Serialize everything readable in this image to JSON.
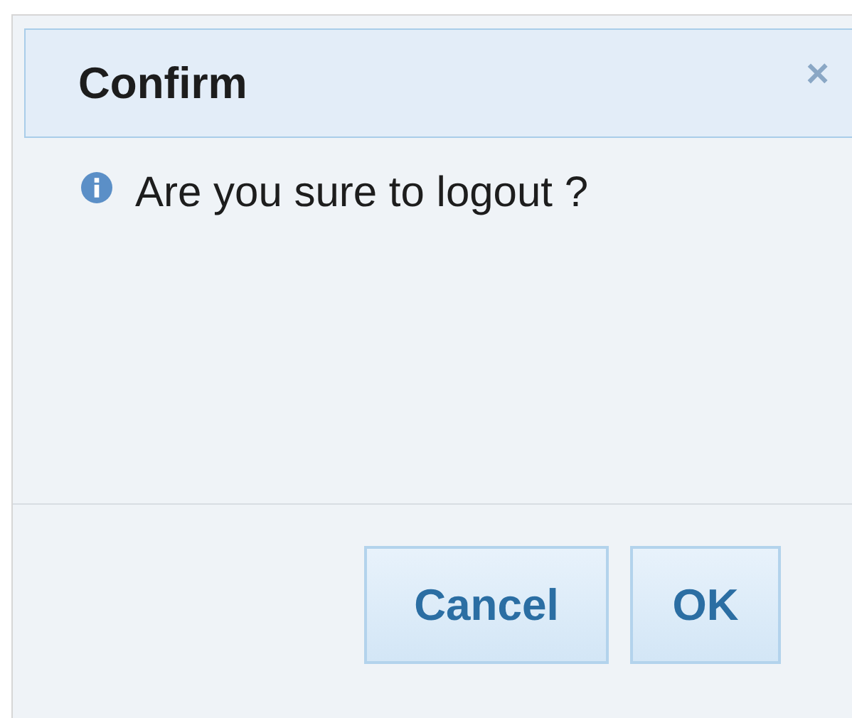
{
  "dialog": {
    "title": "Confirm",
    "close": "×",
    "message": "Are you sure to logout ?",
    "buttons": [
      {
        "label": "Cancel"
      },
      {
        "label": "OK"
      }
    ]
  }
}
